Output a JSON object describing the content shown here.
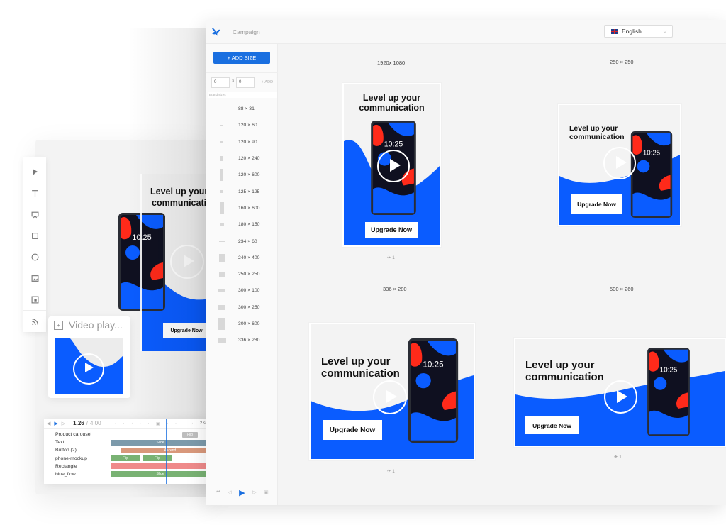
{
  "app": {
    "title": "Campaign",
    "language": "English",
    "add_size_label": "+ ADD SIZE",
    "width_input": "0",
    "height_input": "0",
    "dim_separator": "×",
    "add_label": "+ ADD",
    "brand_sizes_label": "Brand sizes"
  },
  "brand_sizes": [
    {
      "label": "88 × 31"
    },
    {
      "label": "120 × 60"
    },
    {
      "label": "120 × 90"
    },
    {
      "label": "120 × 240"
    },
    {
      "label": "120 × 600"
    },
    {
      "label": "125 × 125"
    },
    {
      "label": "160 × 600"
    },
    {
      "label": "180 × 150"
    },
    {
      "label": "234 × 60"
    },
    {
      "label": "240 × 400"
    },
    {
      "label": "250 × 250"
    },
    {
      "label": "300 × 100"
    },
    {
      "label": "300 × 250"
    },
    {
      "label": "300 × 600"
    },
    {
      "label": "336 × 280"
    }
  ],
  "previews": [
    {
      "size": "1920x 1080",
      "headline_1": "Level up your",
      "headline_2": "communication",
      "cta": "Upgrade Now",
      "clock": "10:25",
      "count": "1"
    },
    {
      "size": "250 × 250",
      "headline_1": "Level up your",
      "headline_2": "communication",
      "cta": "Upgrade Now",
      "clock": "10:25"
    },
    {
      "size": "336 × 280",
      "headline_1": "Level up your",
      "headline_2": "communication",
      "cta": "Upgrade Now",
      "clock": "10:25",
      "count": "1"
    },
    {
      "size": "500 × 260",
      "headline_1": "Level up your",
      "headline_2": "communication",
      "cta": "Upgrade Now",
      "clock": "10:25",
      "count": "1"
    }
  ],
  "editor": {
    "headline_1": "Level up your",
    "headline_2": "communication",
    "cta": "Upgrade Now",
    "clock": "10:25",
    "video_card_title": "Video play..."
  },
  "timeline": {
    "current_time": "1.26",
    "separator": "/",
    "duration": "4.00",
    "tick_label": "2 s",
    "layers": [
      {
        "name": "Product carousel",
        "bars": [
          {
            "label": "Flip",
            "color": "#bdbdbd"
          }
        ]
      },
      {
        "name": "Text",
        "bars": [
          {
            "label": "Slide",
            "color": "#7c9aab"
          }
        ]
      },
      {
        "name": "Button (2)",
        "bars": [
          {
            "label": "Ascend",
            "color": "#d9987b"
          }
        ]
      },
      {
        "name": "phone-mockup",
        "bars": [
          {
            "label": "Flip",
            "color": "#79b273"
          },
          {
            "label": "Flip",
            "color": "#79b273"
          }
        ]
      },
      {
        "name": "Rectangle",
        "bars": [
          {
            "label": "",
            "color": "#ef8a8a"
          }
        ]
      },
      {
        "name": "blue_flow",
        "bars": [
          {
            "label": "Slide",
            "color": "#79b273"
          }
        ]
      }
    ]
  },
  "colors": {
    "accent": "#1a6fe0",
    "ad_blue": "#0a5cff",
    "blob_red": "#ff2a1a",
    "phone_screen": "#0f1020"
  }
}
